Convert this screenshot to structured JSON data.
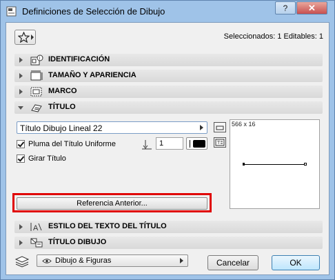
{
  "window": {
    "title": "Definiciones de Selección de Dibujo",
    "help_label": "?",
    "close_label": "✕"
  },
  "header": {
    "selection_info": "Seleccionados: 1 Editables: 1"
  },
  "panels": [
    {
      "label": "IDENTIFICACIÓN",
      "expanded": false,
      "icon": "identification-icon"
    },
    {
      "label": "TAMAÑO Y APARIENCIA",
      "expanded": false,
      "icon": "size-appearance-icon"
    },
    {
      "label": "MARCO",
      "expanded": false,
      "icon": "frame-icon"
    },
    {
      "label": "TÍTULO",
      "expanded": true,
      "icon": "title-icon"
    },
    {
      "label": "ESTILO DEL TEXTO DEL TÍTULO",
      "expanded": false,
      "icon": "text-style-icon"
    },
    {
      "label": "TÍTULO DIBUJO",
      "expanded": false,
      "icon": "drawing-title-icon"
    }
  ],
  "title_panel": {
    "title_type": "Título Dibujo Lineal 22",
    "uniform_pen_label": "Pluma del Título Uniforme",
    "uniform_pen_checked": true,
    "pen_number": "1",
    "rotate_label": "Girar Título",
    "rotate_checked": true,
    "preview_size": "566 x 16",
    "previous_reference_label": "Referencia Anterior..."
  },
  "footer": {
    "layer_value": "Dibujo & Figuras",
    "cancel_label": "Cancelar",
    "ok_label": "OK"
  },
  "colors": {
    "window_frame": "#9fc3e8",
    "dialog_bg": "#f0f0f0",
    "highlight": "#e00000",
    "panel_header": "#dcdcdc"
  }
}
